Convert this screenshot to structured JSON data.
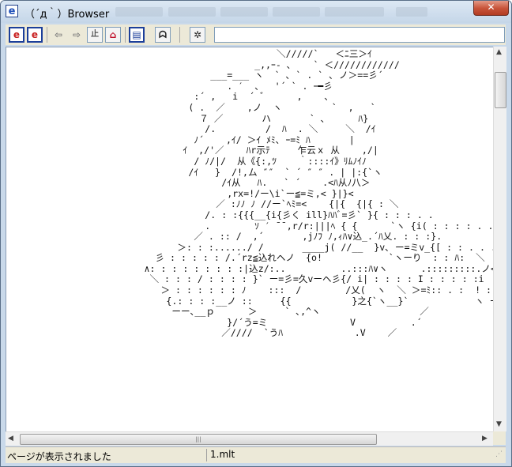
{
  "window": {
    "title": "（´д｀）Browser",
    "app_icon": "e",
    "close_label": "✕"
  },
  "toolbar": {
    "buttons": [
      {
        "name": "ie-icon-button",
        "glyph": "e"
      },
      {
        "name": "ie-icon-red-button",
        "glyph": "e"
      },
      {
        "name": "back-button",
        "glyph": "⇦"
      },
      {
        "name": "forward-button",
        "glyph": "⇨"
      },
      {
        "name": "stop-button",
        "glyph": "止"
      },
      {
        "name": "home-button",
        "glyph": "⌂"
      },
      {
        "name": "favorites-button",
        "glyph": "▤"
      },
      {
        "name": "mona-button",
        "glyph": "ᗣ"
      },
      {
        "name": "settings-button",
        "glyph": "✲"
      }
    ],
    "address_value": ""
  },
  "content": {
    "ascii_art": "                                                 ＼/////`   ＜ﾆ三＞ｲ\n                                             _,,ｰ- ､    ` ＜////////////\n                                     ___=___ ヽ  ` ､ ` . ` ､ ノ＞==彡´\n                                        . ′  、  '´ ` . ｰ━彡\n                                  :´ ,   i  ´ ゛     ,    ､\n                                 ( .  ／    ,ノ  ヽ         `  ,   `\n                                   ７ ／       ハ       ` ､      ﾊ}\n                                    /.         /  ﾊ  . ＼     ＼  /ｲ\n                                  ﾉ´    ,ｲ/ ＞ｲ ﾒﾐ､ ｰ=ﾐ ﾊ       |\n                                ｲ  ,/'／    ﾊr示ﾃ     乍云ｘ 从    ,/|\n                                  / ﾉ/|/  从《{:,ﾂ    ｀::::ｲ》ﾘﾑﾉｲﾉ\n                                 /ｲ   }  /!,ム ″″  ` ´ ″ ″ . | |:{`ヽ\n                                       /ｲ从   ﾊ.   ` ´    .<ﾊ从ﾉ八＞\n                                        ,rx=!/ー\\i`ー≦=ミ,< }|}<\n                                      ／ :ﾉﾉ ﾉ //ー`ﾍﾐ=<    {|{  {|{ : ＼\n                                    /. : :{{{__{i{彡く ill}ﾊﾊﾞ=彡` }{ : : : . .\n                                    .        ｿ ′ ̄ ̄ ,r/r:|||ﾍ { {      `ヽ {i( : : : : . .\n                                  ／ . :: /  ,´       ,jﾉﾌ ﾉ,ｨﾊ∨込_.´ﾊ乂. : : :}.\n                               ＞: : :....../ /       ____j( //__  }v､ ー=ミv_{[ : : . . .\n                           彡 : : : : : /.´rz≦込れヘノ  {o!            `ヽーり  : : ﾊ:  ＼\n                         ∧: : : : : : : : :|込z/:..          ..:::ﾊ∨ヽ      .:::::::::.ノ<` : : : : . : : : ＼\n                          ＼ : : : / : : : : }` ー=彡=久vーヘ彡{/ i| : : : : I : : : : :i\n                            ＞ : : : : : : ﾉ    :::  /        /乂(  ヽ  ＼ ＞=ﾐ:: . :  ! : : ;\n                             {.: : : :__ノ ::     {{           }之{`ヽ__}`            ヽ ー彡\n                              ーー､__ｐ      ＞     ` ､,^ヽ                  ／\n                                        }/´う=ミ               V          .´\n                                       ／////  `うﾊ             .V    ／"
  },
  "status": {
    "message": "ページが表示されました",
    "file": "1.mlt"
  }
}
